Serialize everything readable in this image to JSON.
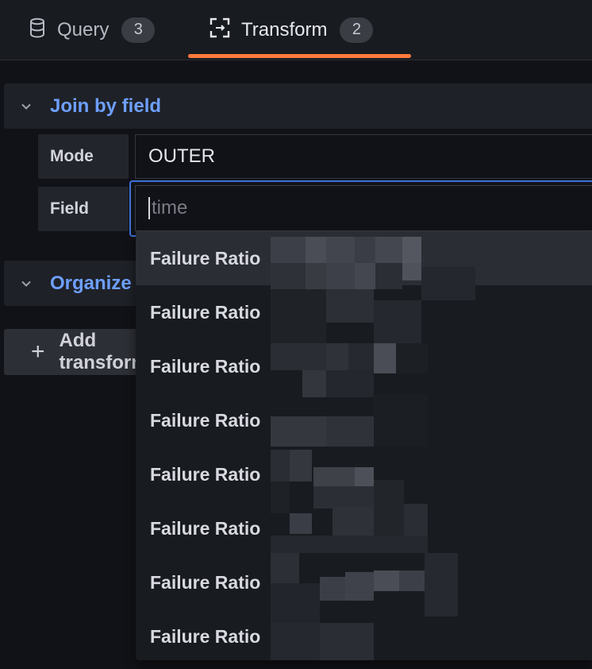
{
  "tabs": [
    {
      "label": "Query",
      "count": "3",
      "icon": "database-icon"
    },
    {
      "label": "Transform",
      "count": "2",
      "icon": "transform-icon",
      "active": true
    }
  ],
  "transformations": [
    {
      "title": "Join by field",
      "expanded": true
    },
    {
      "title": "Organize fields",
      "expanded": false
    }
  ],
  "join": {
    "mode_label": "Mode",
    "mode_value": "OUTER",
    "field_label": "Field",
    "field_placeholder": "time"
  },
  "add_button": {
    "label": "Add transformation"
  },
  "dropdown": {
    "options": [
      "Failure Ratio",
      "Failure Ratio",
      "Failure Ratio",
      "Failure Ratio",
      "Failure Ratio",
      "Failure Ratio",
      "Failure Ratio",
      "Failure Ratio"
    ],
    "highlighted_index": 0
  },
  "colors": {
    "accent_link": "#6e9fff",
    "active_tab_underline": "#ff7a3d",
    "focus_border": "#3d71d9"
  }
}
